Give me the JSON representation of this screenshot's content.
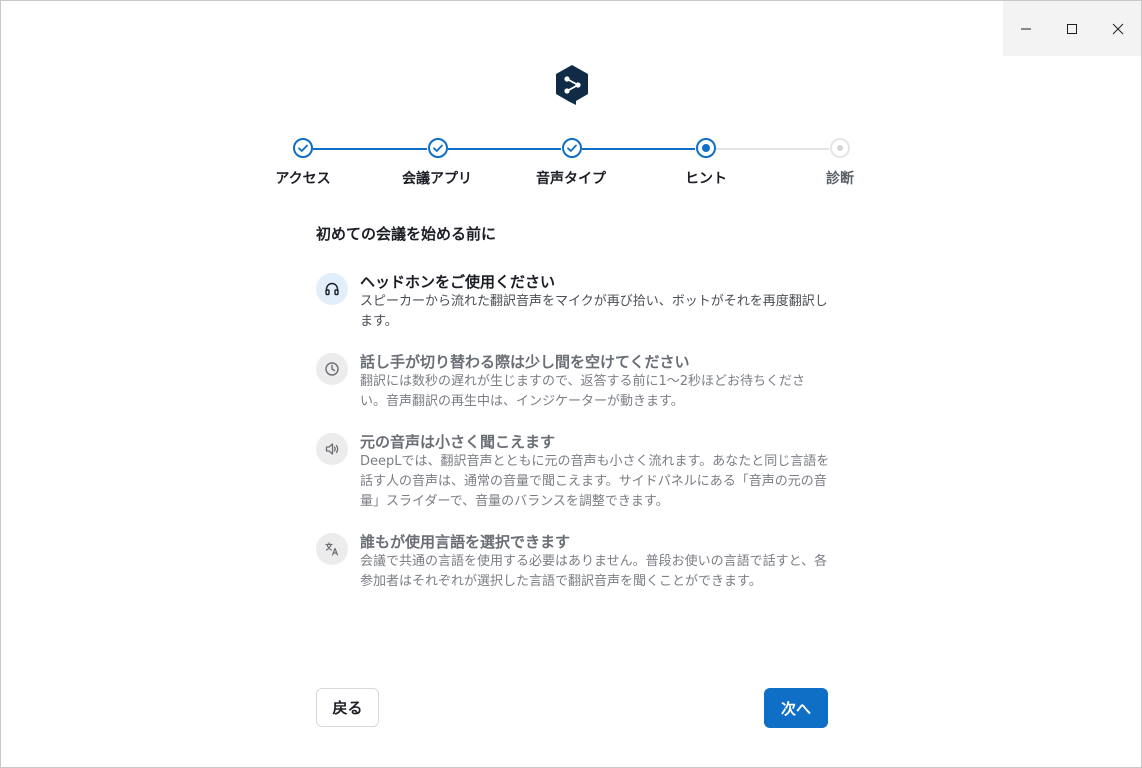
{
  "colors": {
    "accent": "#0f6fc6",
    "brand_logo": "#0f2b46",
    "pending": "#e4e4e4"
  },
  "window_controls": {
    "minimize_icon": "minimize-icon",
    "maximize_icon": "maximize-icon",
    "close_icon": "close-icon"
  },
  "logo": {
    "icon": "deepl-logo-icon"
  },
  "stepper": {
    "steps": [
      {
        "label": "アクセス",
        "state": "done"
      },
      {
        "label": "会議アプリ",
        "state": "done"
      },
      {
        "label": "音声タイプ",
        "state": "done"
      },
      {
        "label": "ヒント",
        "state": "current"
      },
      {
        "label": "診断",
        "state": "pending"
      }
    ]
  },
  "content": {
    "heading": "初めての会議を始める前に",
    "tips": [
      {
        "icon": "headphones-icon",
        "title": "ヘッドホンをご使用ください",
        "body": "スピーカーから流れた翻訳音声をマイクが再び拾い、ボットがそれを再度翻訳します。"
      },
      {
        "icon": "clock-icon",
        "title": "話し手が切り替わる際は少し間を空けてください",
        "body": "翻訳には数秒の遅れが生じますので、返答する前に1〜2秒ほどお待ちください。音声翻訳の再生中は、インジケーターが動きます。"
      },
      {
        "icon": "speaker-volume-icon",
        "title": "元の音声は小さく聞こえます",
        "body": "DeepLでは、翻訳音声とともに元の音声も小さく流れます。あなたと同じ言語を話す人の音声は、通常の音量で聞こえます。サイドパネルにある「音声の元の音量」スライダーで、音量のバランスを調整できます。"
      },
      {
        "icon": "translate-icon",
        "title": "誰もが使用言語を選択できます",
        "body": "会議で共通の言語を使用する必要はありません。普段お使いの言語で話すと、各参加者はそれぞれが選択した言語で翻訳音声を聞くことができます。"
      }
    ]
  },
  "footer": {
    "back_label": "戻る",
    "next_label": "次へ"
  }
}
